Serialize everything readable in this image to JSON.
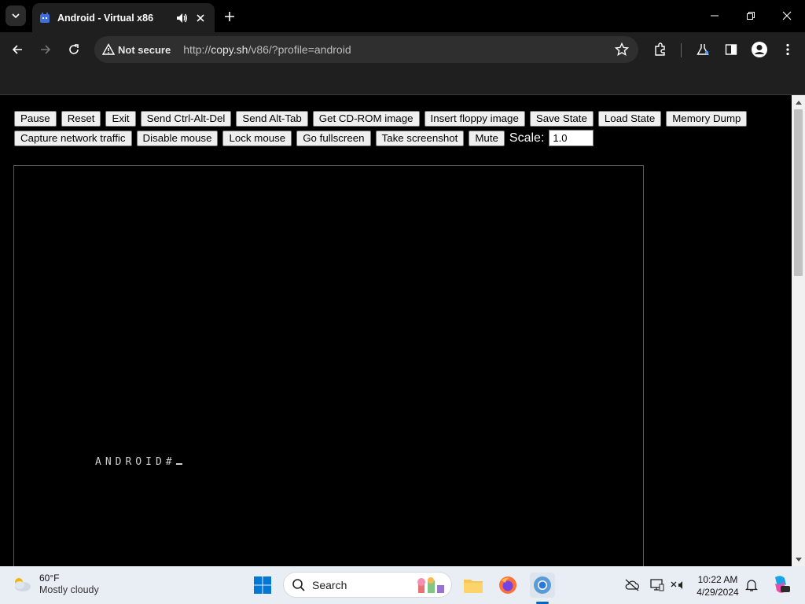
{
  "browser": {
    "tab": {
      "title": "Android - Virtual x86",
      "favicon": "virtual-x86-favicon",
      "audio_icon": "speaker-icon",
      "close_icon": "close-icon"
    },
    "new_tab_icon": "plus-icon",
    "window_controls": [
      "minimize-icon",
      "restore-icon",
      "close-icon"
    ],
    "omnibox": {
      "security_label": "Not secure",
      "url_prefix": "http://",
      "url_domain": "copy.sh",
      "url_path": "/v86/?profile=android"
    }
  },
  "v86": {
    "buttons_row1": [
      "Pause",
      "Reset",
      "Exit",
      "Send Ctrl-Alt-Del",
      "Send Alt-Tab",
      "Get CD-ROM image",
      "Insert floppy image",
      "Save State",
      "Load State",
      "Memory Dump"
    ],
    "buttons_row2": [
      "Capture network traffic",
      "Disable mouse",
      "Lock mouse",
      "Go fullscreen",
      "Take screenshot",
      "Mute"
    ],
    "scale_label": "Scale:",
    "scale_value": "1.0",
    "terminal_prompt": "ANDROID#"
  },
  "taskbar": {
    "weather_temp": "60°F",
    "weather_condition": "Mostly cloudy",
    "search_placeholder": "Search",
    "time": "10:22 AM",
    "date": "4/29/2024"
  }
}
